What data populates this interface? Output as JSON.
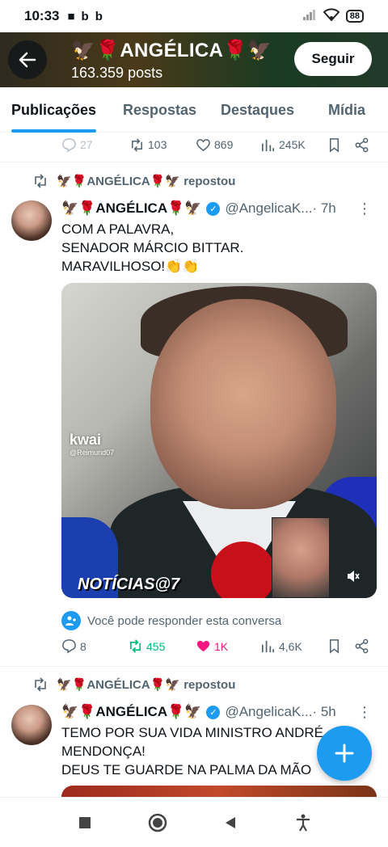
{
  "status_bar": {
    "time": "10:33",
    "icons": [
      "video-icon",
      "b-icon",
      "b-icon"
    ],
    "battery": "88"
  },
  "header": {
    "name": "🦅🌹ANGÉLICA🌹🦅",
    "posts": "163.359 posts",
    "follow_label": "Seguir"
  },
  "tabs": [
    {
      "label": "Publicações",
      "active": true
    },
    {
      "label": "Respostas",
      "active": false
    },
    {
      "label": "Destaques",
      "active": false
    },
    {
      "label": "Mídia",
      "active": false
    }
  ],
  "prev_actions": {
    "replies": "27",
    "reposts": "103",
    "likes": "869",
    "views": "245K"
  },
  "post1": {
    "repost_label": "🦅🌹ANGÉLICA🌹🦅 repostou",
    "author": "🦅🌹ANGÉLICA🌹🦅",
    "handle": "@AngelicaK...",
    "time": " · 7h",
    "text_line1": "COM A PALAVRA,",
    "text_line2": "SENADOR MÁRCIO BITTAR.",
    "text_line3": "MARAVILHOSO!👏👏",
    "media_watermark": "kwai",
    "media_watermark_user": "@Reimund07",
    "media_caption": "NOTÍCIAS@7",
    "reply_note": "Você pode responder esta conversa",
    "replies": "8",
    "reposts": "455",
    "likes": "1K",
    "views": "4,6K"
  },
  "post2": {
    "repost_label": "🦅🌹ANGÉLICA🌹🦅 repostou",
    "author": "🦅🌹ANGÉLICA🌹🦅",
    "handle": "@AngelicaK...",
    "time": " · 5h",
    "text_line1": "TEMO POR SUA VIDA MINISTRO ANDRÉ",
    "text_line2": "MENDONÇA!",
    "text_line3": "DEUS TE GUARDE NA PALMA DA MÃO"
  },
  "colors": {
    "accent": "#1d9bf0",
    "repost_green": "#00ba7c",
    "like_pink": "#f91880",
    "muted": "#536471"
  }
}
